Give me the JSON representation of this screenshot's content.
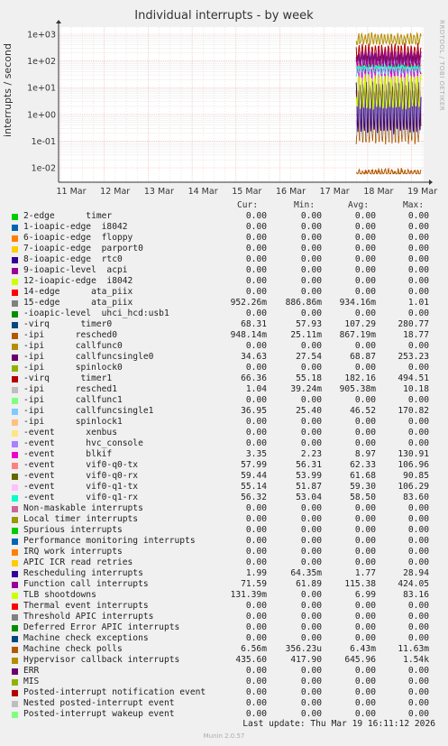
{
  "title": "Individual interrupts - by week",
  "side_text": "RRDTOOL / TOBI OETIKER",
  "footer": "Last update: Thu Mar 19 16:11:12 2026",
  "munin_version": "Munin 2.0.57",
  "columns": [
    "Cur:",
    "Min:",
    "Avg:",
    "Max:"
  ],
  "chart_data": {
    "type": "line",
    "title": "Individual interrupts - by week",
    "xlabel": "",
    "ylabel": "interrupts / second",
    "y_scale": "log",
    "ylim": [
      0.005,
      2000
    ],
    "y_ticks": [
      "1e-02",
      "1e-01",
      "1e+00",
      "1e+01",
      "1e+02",
      "1e+03"
    ],
    "x_ticks": [
      "11 Mar",
      "12 Mar",
      "13 Mar",
      "14 Mar",
      "15 Mar",
      "16 Mar",
      "17 Mar",
      "18 Mar",
      "19 Mar"
    ],
    "data_start": "17 Mar (about 09:00)",
    "grid": true,
    "series": [
      {
        "name": "2-edge      timer",
        "color": "#00cc00",
        "cur": "0.00",
        "min": "0.00",
        "avg": "0.00",
        "max": "0.00"
      },
      {
        "name": "1-ioapic-edge  i8042",
        "color": "#0066b3",
        "cur": "0.00",
        "min": "0.00",
        "avg": "0.00",
        "max": "0.00"
      },
      {
        "name": "6-ioapic-edge  floppy",
        "color": "#ff8000",
        "cur": "0.00",
        "min": "0.00",
        "avg": "0.00",
        "max": "0.00"
      },
      {
        "name": "7-ioapic-edge  parport0",
        "color": "#ffcc00",
        "cur": "0.00",
        "min": "0.00",
        "avg": "0.00",
        "max": "0.00"
      },
      {
        "name": "8-ioapic-edge  rtc0",
        "color": "#330099",
        "cur": "0.00",
        "min": "0.00",
        "avg": "0.00",
        "max": "0.00"
      },
      {
        "name": "9-ioapic-level  acpi",
        "color": "#990099",
        "cur": "0.00",
        "min": "0.00",
        "avg": "0.00",
        "max": "0.00"
      },
      {
        "name": "12-ioapic-edge  i8042",
        "color": "#ccff00",
        "cur": "0.00",
        "min": "0.00",
        "avg": "0.00",
        "max": "0.00"
      },
      {
        "name": "14-edge      ata_piix",
        "color": "#ff0000",
        "cur": "0.00",
        "min": "0.00",
        "avg": "0.00",
        "max": "0.00"
      },
      {
        "name": "15-edge      ata_piix",
        "color": "#808080",
        "cur": "952.26m",
        "min": "886.86m",
        "avg": "934.16m",
        "max": "1.01"
      },
      {
        "name": "-ioapic-level  uhci_hcd:usb1",
        "color": "#008f00",
        "cur": "0.00",
        "min": "0.00",
        "avg": "0.00",
        "max": "0.00"
      },
      {
        "name": "-virq      timer0",
        "color": "#00487d",
        "cur": "68.31",
        "min": "57.93",
        "avg": "107.29",
        "max": "280.77"
      },
      {
        "name": "-ipi      resched0",
        "color": "#b35a00",
        "cur": "948.14m",
        "min": "25.11m",
        "avg": "867.19m",
        "max": "18.77"
      },
      {
        "name": "-ipi      callfunc0",
        "color": "#b38f00",
        "cur": "0.00",
        "min": "0.00",
        "avg": "0.00",
        "max": "0.00"
      },
      {
        "name": "-ipi      callfuncsingle0",
        "color": "#6b006b",
        "cur": "34.63",
        "min": "27.54",
        "avg": "68.87",
        "max": "253.23"
      },
      {
        "name": "-ipi      spinlock0",
        "color": "#8fb300",
        "cur": "0.00",
        "min": "0.00",
        "avg": "0.00",
        "max": "0.00"
      },
      {
        "name": "-virq      timer1",
        "color": "#b30000",
        "cur": "66.36",
        "min": "55.18",
        "avg": "182.16",
        "max": "494.51"
      },
      {
        "name": "-ipi      resched1",
        "color": "#bebebe",
        "cur": "1.04",
        "min": "39.24m",
        "avg": "905.38m",
        "max": "10.18"
      },
      {
        "name": "-ipi      callfunc1",
        "color": "#80ff80",
        "cur": "0.00",
        "min": "0.00",
        "avg": "0.00",
        "max": "0.00"
      },
      {
        "name": "-ipi      callfuncsingle1",
        "color": "#80c9ff",
        "cur": "36.95",
        "min": "25.40",
        "avg": "46.52",
        "max": "170.82"
      },
      {
        "name": "-ipi      spinlock1",
        "color": "#ffc080",
        "cur": "0.00",
        "min": "0.00",
        "avg": "0.00",
        "max": "0.00"
      },
      {
        "name": "-event      xenbus",
        "color": "#ffe680",
        "cur": "0.00",
        "min": "0.00",
        "avg": "0.00",
        "max": "0.00"
      },
      {
        "name": "-event      hvc_console",
        "color": "#aa80ff",
        "cur": "0.00",
        "min": "0.00",
        "avg": "0.00",
        "max": "0.00"
      },
      {
        "name": "-event      blkif",
        "color": "#ee00cc",
        "cur": "3.35",
        "min": "2.23",
        "avg": "8.97",
        "max": "130.91"
      },
      {
        "name": "-event      vif0-q0-tx",
        "color": "#ff8080",
        "cur": "57.99",
        "min": "56.31",
        "avg": "62.33",
        "max": "106.96"
      },
      {
        "name": "-event      vif0-q0-rx",
        "color": "#666600",
        "cur": "59.44",
        "min": "53.99",
        "avg": "61.68",
        "max": "90.85"
      },
      {
        "name": "-event      vif0-q1-tx",
        "color": "#ffbfff",
        "cur": "55.14",
        "min": "51.87",
        "avg": "59.30",
        "max": "106.29"
      },
      {
        "name": "-event      vif0-q1-rx",
        "color": "#00ffcc",
        "cur": "56.32",
        "min": "53.04",
        "avg": "58.50",
        "max": "83.60"
      },
      {
        "name": "Non-maskable interrupts",
        "color": "#cc6699",
        "cur": "0.00",
        "min": "0.00",
        "avg": "0.00",
        "max": "0.00"
      },
      {
        "name": "Local timer interrupts",
        "color": "#999900",
        "cur": "0.00",
        "min": "0.00",
        "avg": "0.00",
        "max": "0.00"
      },
      {
        "name": "Spurious interrupts",
        "color": "#00cc00",
        "cur": "0.00",
        "min": "0.00",
        "avg": "0.00",
        "max": "0.00"
      },
      {
        "name": "Performance monitoring interrupts",
        "color": "#0066b3",
        "cur": "0.00",
        "min": "0.00",
        "avg": "0.00",
        "max": "0.00"
      },
      {
        "name": "IRQ work interrupts",
        "color": "#ff8000",
        "cur": "0.00",
        "min": "0.00",
        "avg": "0.00",
        "max": "0.00"
      },
      {
        "name": "APIC ICR read retries",
        "color": "#ffcc00",
        "cur": "0.00",
        "min": "0.00",
        "avg": "0.00",
        "max": "0.00"
      },
      {
        "name": "Rescheduling interrupts",
        "color": "#330099",
        "cur": "1.99",
        "min": "64.35m",
        "avg": "1.77",
        "max": "28.94"
      },
      {
        "name": "Function call interrupts",
        "color": "#990099",
        "cur": "71.59",
        "min": "61.89",
        "avg": "115.38",
        "max": "424.05"
      },
      {
        "name": "TLB shootdowns",
        "color": "#ccff00",
        "cur": "131.39m",
        "min": "0.00",
        "avg": "6.99",
        "max": "83.16"
      },
      {
        "name": "Thermal event interrupts",
        "color": "#ff0000",
        "cur": "0.00",
        "min": "0.00",
        "avg": "0.00",
        "max": "0.00"
      },
      {
        "name": "Threshold APIC interrupts",
        "color": "#808080",
        "cur": "0.00",
        "min": "0.00",
        "avg": "0.00",
        "max": "0.00"
      },
      {
        "name": "Deferred Error APIC interrupts",
        "color": "#008f00",
        "cur": "0.00",
        "min": "0.00",
        "avg": "0.00",
        "max": "0.00"
      },
      {
        "name": "Machine check exceptions",
        "color": "#00487d",
        "cur": "0.00",
        "min": "0.00",
        "avg": "0.00",
        "max": "0.00"
      },
      {
        "name": "Machine check polls",
        "color": "#b35a00",
        "cur": "6.56m",
        "min": "356.23u",
        "avg": "6.43m",
        "max": "11.63m"
      },
      {
        "name": "Hypervisor callback interrupts",
        "color": "#b38f00",
        "cur": "435.60",
        "min": "417.90",
        "avg": "645.96",
        "max": "1.54k"
      },
      {
        "name": "ERR",
        "color": "#6b006b",
        "cur": "0.00",
        "min": "0.00",
        "avg": "0.00",
        "max": "0.00"
      },
      {
        "name": "MIS",
        "color": "#8fb300",
        "cur": "0.00",
        "min": "0.00",
        "avg": "0.00",
        "max": "0.00"
      },
      {
        "name": "Posted-interrupt notification event",
        "color": "#b30000",
        "cur": "0.00",
        "min": "0.00",
        "avg": "0.00",
        "max": "0.00"
      },
      {
        "name": "Nested posted-interrupt event",
        "color": "#bebebe",
        "cur": "0.00",
        "min": "0.00",
        "avg": "0.00",
        "max": "0.00"
      },
      {
        "name": "Posted-interrupt wakeup event",
        "color": "#80ff80",
        "cur": "0.00",
        "min": "0.00",
        "avg": "0.00",
        "max": "0.00"
      }
    ]
  }
}
